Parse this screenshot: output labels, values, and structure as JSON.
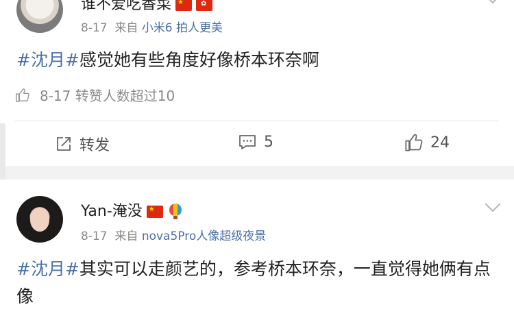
{
  "post1": {
    "username": "谁不爱吃香菜",
    "meta_date": "8-17",
    "meta_from": "来自",
    "meta_source": "小米6 拍人更美",
    "tag": "#沈月#",
    "content": "感觉她有些角度好像桥本环奈啊",
    "repost_info": "8-17 转赞人数超过10",
    "actions": {
      "share_label": "转发",
      "comment_count": "5",
      "like_count": "24"
    }
  },
  "post2": {
    "username": "Yan-淹没",
    "meta_date": "8-17",
    "meta_from": "来自",
    "meta_source": "nova5Pro人像超级夜景",
    "tag": "#沈月#",
    "content": "其实可以走颜艺的，参考桥本环奈，一直觉得她俩有点像"
  },
  "colors": {
    "link": "#4a6fa5",
    "meta": "#8a8a8a",
    "divider": "#e6e6e6",
    "gap": "#f2f2f2"
  },
  "icons": [
    "china-flag-icon",
    "hongkong-flag-icon",
    "hot-air-balloon-icon",
    "thumb-up-icon",
    "share-icon",
    "comment-icon",
    "chevron-down-icon"
  ]
}
